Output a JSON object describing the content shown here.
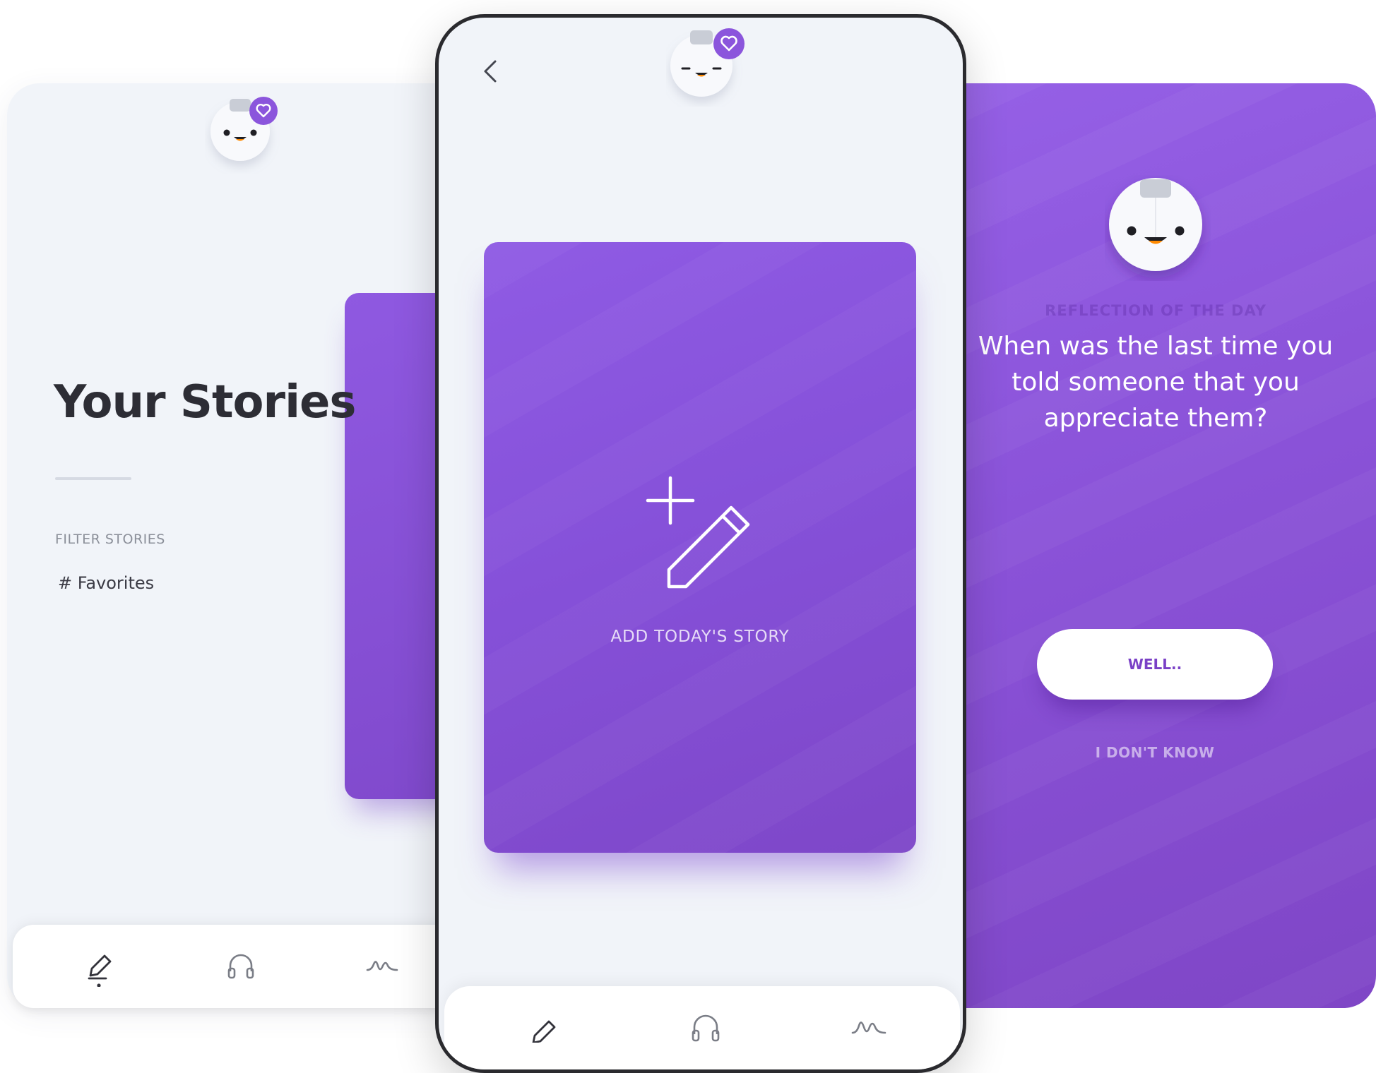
{
  "colors": {
    "accent": "#8b55dc",
    "accent_dark": "#7a40c6",
    "screen_bg": "#f1f4f9",
    "title_text": "#2d2d35"
  },
  "left_screen": {
    "title": "Your Stories",
    "filter_label": "FILTER STORIES",
    "filter_items": [
      "# Favorites"
    ],
    "tabbar": {
      "icons": [
        "pencil-icon",
        "headphones-icon",
        "wave-icon"
      ],
      "active": "pencil-icon"
    }
  },
  "center_screen": {
    "back_icon": "chevron-left-icon",
    "card": {
      "icon": "add-pencil-icon",
      "label": "ADD TODAY'S STORY"
    },
    "tabbar": {
      "icons": [
        "pencil-icon",
        "headphones-icon",
        "wave-icon"
      ]
    }
  },
  "right_screen": {
    "label": "REFLECTION OF THE DAY",
    "question": "When was the last time you told someone that you appreciate them?",
    "primary_button": "WELL..",
    "secondary_link": "I DON'T KNOW"
  },
  "avatar": {
    "icon": "mascot-face-icon",
    "badge": "heart-icon"
  }
}
